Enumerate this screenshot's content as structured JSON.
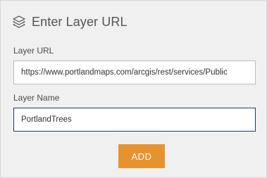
{
  "header": {
    "icon": "layers-icon",
    "title": "Enter Layer URL"
  },
  "form": {
    "url_label": "Layer URL",
    "url_value": "https://www.portlandmaps.com/arcgis/rest/services/Public",
    "name_label": "Layer Name",
    "name_value": "PortlandTrees"
  },
  "actions": {
    "add_label": "ADD"
  },
  "colors": {
    "accent": "#e8922e",
    "panel_bg": "#f0f0f0",
    "focus_border": "#1f3b63"
  }
}
